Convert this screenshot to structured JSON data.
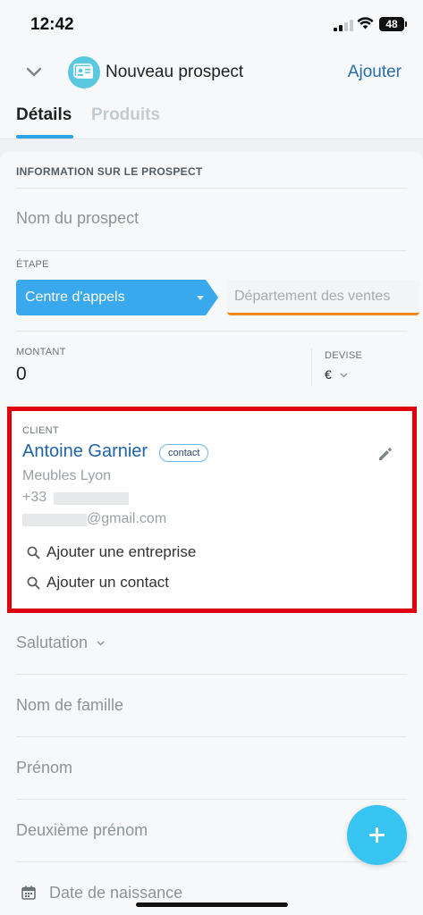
{
  "status_bar": {
    "time": "12:42",
    "battery": "48"
  },
  "header": {
    "title": "Nouveau prospect",
    "add_label": "Ajouter",
    "tabs": [
      {
        "label": "Détails",
        "active": true
      },
      {
        "label": "Produits",
        "active": false
      }
    ]
  },
  "form": {
    "section_title": "INFORMATION SUR LE PROSPECT",
    "name_placeholder": "Nom du prospect",
    "stage": {
      "label": "ÉTAPE",
      "active": "Centre d'appels",
      "next": "Département des ventes"
    },
    "amount": {
      "label": "MONTANT",
      "value": "0"
    },
    "currency": {
      "label": "DEVISE",
      "value": "€"
    },
    "client": {
      "label": "CLIENT",
      "name": "Antoine Garnier",
      "badge": "contact",
      "company": "Meubles Lyon",
      "phone_prefix": "+33",
      "email_suffix": "@gmail.com",
      "add_company": "Ajouter une entreprise",
      "add_contact": "Ajouter un contact"
    },
    "salutation": "Salutation",
    "last_name": "Nom de famille",
    "first_name": "Prénom",
    "middle_name": "Deuxième prénom",
    "birth_date": "Date de naissance"
  },
  "colors": {
    "accent": "#2fa3e5",
    "highlight_border": "#e0000d",
    "stage_active": "#3aa8ec",
    "stage_next_underline": "#f28a1a",
    "fab": "#38c4f1"
  }
}
